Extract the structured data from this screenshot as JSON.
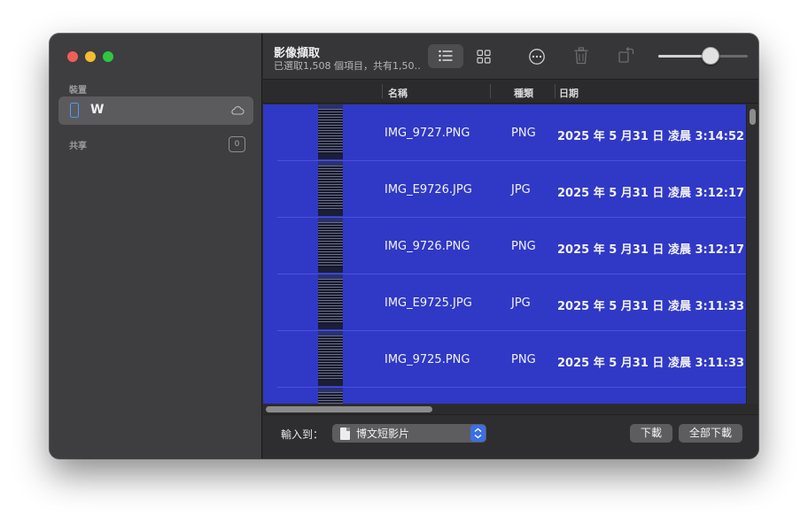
{
  "window": {
    "title": "影像擷取"
  },
  "sidebar": {
    "devices_heading": "裝置",
    "device": {
      "name": "W",
      "icon": "iphone-icon",
      "status_icon": "cloud-icon"
    },
    "shared_heading": "共享",
    "shared_count": "0"
  },
  "toolbar": {
    "title": "影像擷取",
    "subtitle": "已選取1,508 個項目，共有1,50…",
    "view_list_icon": "list-view-icon",
    "view_grid_icon": "grid-view-icon",
    "more_icon": "ellipsis-circle-icon",
    "delete_icon": "trash-icon",
    "rotate_icon": "rotate-icon",
    "thumbnail_size": 0.58
  },
  "table": {
    "columns": [
      "名稱",
      "種類",
      "日期"
    ],
    "rows": [
      {
        "name": "IMG_9727.PNG",
        "kind": "PNG",
        "date": "2025 年 5 月31 日 凌晨 3:14:52"
      },
      {
        "name": "IMG_E9726.JPG",
        "kind": "JPG",
        "date": "2025 年 5 月31 日 凌晨 3:12:17"
      },
      {
        "name": "IMG_9726.PNG",
        "kind": "PNG",
        "date": "2025 年 5 月31 日 凌晨 3:12:17"
      },
      {
        "name": "IMG_E9725.JPG",
        "kind": "JPG",
        "date": "2025 年 5 月31 日 凌晨 3:11:33"
      },
      {
        "name": "IMG_9725.PNG",
        "kind": "PNG",
        "date": "2025 年 5 月31 日 凌晨 3:11:33"
      },
      {
        "name": "",
        "kind": "",
        "date": ""
      }
    ]
  },
  "footer": {
    "import_label": "輸入到：",
    "destination": "博文短影片",
    "download_label": "下載",
    "download_all_label": "全部下載"
  },
  "colors": {
    "selection": "#3038c6",
    "accent": "#3c6ee6",
    "close": "#ee5f57",
    "minimize": "#f3bd2f",
    "maximize": "#2ec840"
  }
}
